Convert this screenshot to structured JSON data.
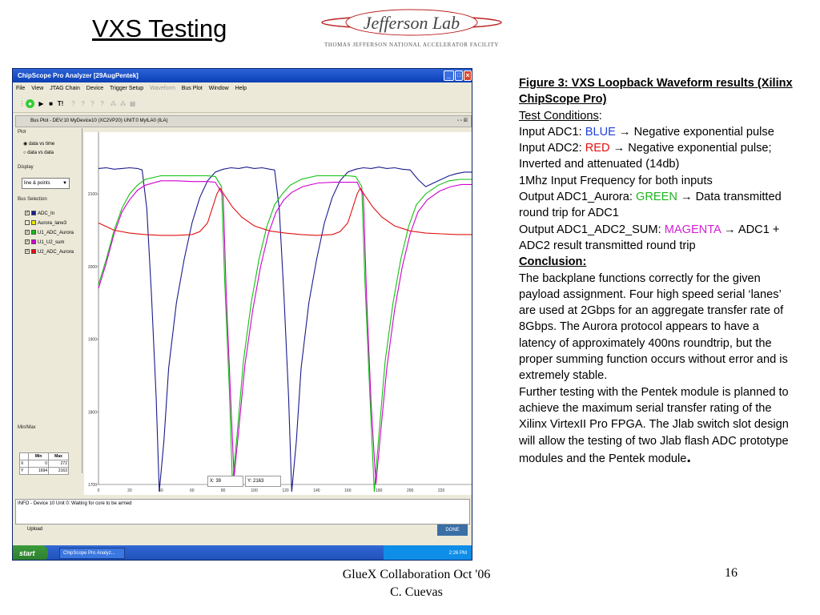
{
  "slide": {
    "title": "VXS Testing",
    "logo_text": "Jefferson Lab",
    "logo_subtitle": "Thomas Jefferson National Accelerator Facility",
    "footer_line1": "GlueX Collaboration Oct '06",
    "footer_line2": "C. Cuevas",
    "page_number": "16"
  },
  "app": {
    "window_title": "ChipScope Pro Analyzer [29AugPentek]",
    "menu": [
      "File",
      "View",
      "JTAG Chain",
      "Device",
      "Trigger Setup",
      "Waveform",
      "Bus Plot",
      "Window",
      "Help"
    ],
    "inner_title": "Bus Plot - DEV:10 MyDevice10 (XC2VP20) UNIT:0 MyILA0 (ILA)",
    "plot_group": "Plot",
    "radio_time": "data vs time",
    "radio_data": "data vs data",
    "display_group": "Display",
    "display_value": "line & points",
    "bus_group": "Bus Selection",
    "buses": [
      {
        "name": "ADC_In",
        "color": "#1a1a8c",
        "checked": "✓"
      },
      {
        "name": "Aurora_lane3",
        "color": "#e8e800",
        "checked": ""
      },
      {
        "name": "U1_ADC_Aurora",
        "color": "#10c010",
        "checked": "✓"
      },
      {
        "name": "U1_U2_sum",
        "color": "#d000d0",
        "checked": "✓"
      },
      {
        "name": "U2_ADC_Aurora",
        "color": "#e01010",
        "checked": "✓"
      }
    ],
    "minmax_group": "Min/Max",
    "mm_head": [
      "Min",
      "Max"
    ],
    "mm_rows": [
      [
        "X",
        "0",
        "272"
      ],
      [
        "Y",
        "1694",
        "2163"
      ]
    ],
    "status_x": "X: 39",
    "status_y": "Y: 2163",
    "info": "INFO - Device 10 Unit 0:  Waiting for core to be armed",
    "upload": "Upload",
    "done": "DONE",
    "start": "start",
    "task": "ChipScope Pro Analyz...",
    "clock": "2:26 PM"
  },
  "chart_data": {
    "type": "line",
    "xlim": [
      0,
      240
    ],
    "ylim": [
      1700,
      2163
    ],
    "x_ticks": [
      0,
      20,
      40,
      60,
      80,
      100,
      120,
      140,
      160,
      180,
      200,
      220
    ],
    "y_ticks": [
      1700,
      1800,
      1900,
      2000,
      2100
    ],
    "series": [
      {
        "name": "ADC_In",
        "color": "#1a1a8c",
        "points": [
          [
            0,
            2135
          ],
          [
            5,
            2136
          ],
          [
            10,
            2134
          ],
          [
            15,
            2135
          ],
          [
            20,
            2136
          ],
          [
            25,
            2135
          ],
          [
            28,
            2133
          ],
          [
            31,
            2080
          ],
          [
            34,
            1960
          ],
          [
            37,
            1820
          ],
          [
            39,
            1690
          ],
          [
            42,
            1760
          ],
          [
            45,
            1860
          ],
          [
            50,
            1950
          ],
          [
            55,
            2010
          ],
          [
            60,
            2060
          ],
          [
            65,
            2095
          ],
          [
            70,
            2118
          ],
          [
            75,
            2130
          ],
          [
            80,
            2134
          ],
          [
            85,
            2136
          ],
          [
            90,
            2135
          ],
          [
            95,
            2137
          ],
          [
            100,
            2135
          ],
          [
            105,
            2136
          ],
          [
            110,
            2134
          ],
          [
            113,
            2133
          ],
          [
            116,
            2080
          ],
          [
            119,
            1960
          ],
          [
            122,
            1820
          ],
          [
            124,
            1690
          ],
          [
            127,
            1760
          ],
          [
            130,
            1860
          ],
          [
            135,
            1950
          ],
          [
            140,
            2010
          ],
          [
            145,
            2060
          ],
          [
            150,
            2095
          ],
          [
            155,
            2118
          ],
          [
            160,
            2130
          ],
          [
            165,
            2134
          ],
          [
            170,
            2136
          ],
          [
            175,
            2135
          ],
          [
            180,
            2137
          ],
          [
            185,
            2135
          ],
          [
            190,
            2136
          ],
          [
            195,
            2134
          ],
          [
            200,
            2133
          ],
          [
            205,
            2120
          ],
          [
            210,
            2110
          ],
          [
            215,
            2115
          ],
          [
            220,
            2120
          ],
          [
            225,
            2125
          ],
          [
            230,
            2128
          ],
          [
            235,
            2130
          ],
          [
            240,
            2130
          ]
        ]
      },
      {
        "name": "U1_ADC_Aurora",
        "color": "#10c010",
        "points": [
          [
            0,
            1975
          ],
          [
            5,
            2010
          ],
          [
            10,
            2050
          ],
          [
            15,
            2080
          ],
          [
            20,
            2100
          ],
          [
            25,
            2112
          ],
          [
            30,
            2120
          ],
          [
            40,
            2125
          ],
          [
            50,
            2125
          ],
          [
            60,
            2125
          ],
          [
            70,
            2125
          ],
          [
            75,
            2124
          ],
          [
            79,
            2110
          ],
          [
            81,
            1980
          ],
          [
            84,
            1830
          ],
          [
            86,
            1700
          ],
          [
            89,
            1770
          ],
          [
            93,
            1870
          ],
          [
            98,
            1950
          ],
          [
            103,
            2010
          ],
          [
            108,
            2055
          ],
          [
            113,
            2085
          ],
          [
            118,
            2100
          ],
          [
            123,
            2112
          ],
          [
            130,
            2120
          ],
          [
            140,
            2125
          ],
          [
            150,
            2125
          ],
          [
            160,
            2125
          ],
          [
            165,
            2124
          ],
          [
            169,
            2110
          ],
          [
            171,
            1980
          ],
          [
            174,
            1830
          ],
          [
            177,
            1690
          ],
          [
            180,
            1770
          ],
          [
            184,
            1870
          ],
          [
            189,
            1950
          ],
          [
            194,
            2010
          ],
          [
            199,
            2055
          ],
          [
            204,
            2085
          ],
          [
            210,
            2100
          ],
          [
            218,
            2112
          ],
          [
            225,
            2118
          ],
          [
            232,
            2120
          ],
          [
            240,
            2120
          ]
        ]
      },
      {
        "name": "U1_U2_sum",
        "color": "#d000d0",
        "points": [
          [
            0,
            1970
          ],
          [
            5,
            2005
          ],
          [
            10,
            2045
          ],
          [
            15,
            2075
          ],
          [
            20,
            2092
          ],
          [
            25,
            2105
          ],
          [
            30,
            2112
          ],
          [
            40,
            2118
          ],
          [
            50,
            2118
          ],
          [
            60,
            2117
          ],
          [
            70,
            2117
          ],
          [
            75,
            2116
          ],
          [
            80,
            2098
          ],
          [
            82,
            1960
          ],
          [
            85,
            1810
          ],
          [
            87,
            1710
          ],
          [
            90,
            1775
          ],
          [
            94,
            1865
          ],
          [
            99,
            1940
          ],
          [
            104,
            2000
          ],
          [
            109,
            2045
          ],
          [
            114,
            2075
          ],
          [
            119,
            2092
          ],
          [
            124,
            2102
          ],
          [
            131,
            2110
          ],
          [
            141,
            2115
          ],
          [
            151,
            2116
          ],
          [
            161,
            2116
          ],
          [
            166,
            2116
          ],
          [
            170,
            2098
          ],
          [
            172,
            1960
          ],
          [
            175,
            1810
          ],
          [
            178,
            1700
          ],
          [
            181,
            1770
          ],
          [
            185,
            1860
          ],
          [
            190,
            1940
          ],
          [
            195,
            2000
          ],
          [
            200,
            2045
          ],
          [
            205,
            2075
          ],
          [
            211,
            2092
          ],
          [
            219,
            2104
          ],
          [
            226,
            2110
          ],
          [
            233,
            2113
          ],
          [
            240,
            2113
          ]
        ]
      },
      {
        "name": "U2_ADC_Aurora",
        "color": "#e01010",
        "points": [
          [
            0,
            2060
          ],
          [
            10,
            2050
          ],
          [
            20,
            2046
          ],
          [
            30,
            2044
          ],
          [
            40,
            2043
          ],
          [
            50,
            2043
          ],
          [
            60,
            2044
          ],
          [
            65,
            2048
          ],
          [
            70,
            2060
          ],
          [
            73,
            2080
          ],
          [
            76,
            2100
          ],
          [
            78,
            2108
          ],
          [
            81,
            2098
          ],
          [
            86,
            2082
          ],
          [
            92,
            2068
          ],
          [
            100,
            2056
          ],
          [
            110,
            2049
          ],
          [
            120,
            2046
          ],
          [
            130,
            2044
          ],
          [
            140,
            2043
          ],
          [
            150,
            2044
          ],
          [
            155,
            2048
          ],
          [
            160,
            2060
          ],
          [
            163,
            2080
          ],
          [
            166,
            2100
          ],
          [
            168,
            2108
          ],
          [
            171,
            2098
          ],
          [
            176,
            2082
          ],
          [
            182,
            2068
          ],
          [
            190,
            2056
          ],
          [
            200,
            2049
          ],
          [
            210,
            2046
          ],
          [
            220,
            2045
          ],
          [
            230,
            2044
          ],
          [
            240,
            2044
          ]
        ]
      }
    ]
  },
  "notes": {
    "fig_title": "Figure 3:  VXS Loopback Waveform results (Xilinx ChipScope Pro)",
    "test_conditions": "Test Conditions",
    "colon": ":",
    "in1_prefix": "Input ADC1:  ",
    "in1_color": "BLUE",
    "in1_suffix": " →  Negative exponential pulse",
    "in2_prefix": "Input ADC2:  ",
    "in2_color": "RED",
    "in2_suffix": " →    Negative exponential pulse; Inverted and attenuated (14db)",
    "freq": "1Mhz Input Frequency for both inputs",
    "out1_prefix": "Output ADC1_Aurora:  ",
    "out1_color": "GREEN",
    "out1_suffix": " →  Data transmitted round trip for ADC1",
    "out2_prefix": "Output ADC1_ADC2_SUM:  ",
    "out2_color": "MAGENTA",
    "out2_suffix": " → ADC1 + ADC2 result transmitted round trip",
    "conclusion": "Conclusion:",
    "conclusion_text": "The backplane functions correctly for the given payload assignment.  Four high speed serial ‘lanes’ are used at 2Gbps for an aggregate transfer rate of 8Gbps.  The Aurora protocol appears to have a latency of approximately 400ns roundtrip, but the proper summing function occurs without error and is extremely stable.",
    "further_text": "Further testing with the Pentek module is planned to achieve the maximum serial transfer rating of the Xilinx VirtexII Pro FPGA.  The Jlab switch slot design will allow the testing of two Jlab flash ADC prototype modules and the Pentek module",
    "final_period": "."
  }
}
